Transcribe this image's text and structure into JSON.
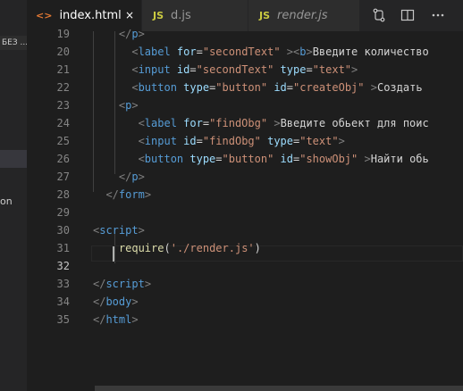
{
  "sidebar": {
    "section_label": "БЕЗ ...",
    "item_label": "on"
  },
  "tabs": [
    {
      "label": "index.html",
      "icon": "<>",
      "active": true,
      "close": "×"
    },
    {
      "label": "d.js",
      "icon": "JS",
      "active": false
    },
    {
      "label": "render.js",
      "icon": "JS",
      "active": false
    }
  ],
  "editor": {
    "current_line": 32,
    "lines": [
      {
        "n": "19",
        "tokens": [
          [
            "t",
            "    </"
          ],
          [
            "tn",
            "p"
          ],
          [
            "t",
            ">"
          ]
        ]
      },
      {
        "n": "20",
        "tokens": [
          [
            "t",
            "      <"
          ],
          [
            "tn",
            "label"
          ],
          [
            "at",
            " for"
          ],
          [
            "tx",
            "="
          ],
          [
            "st",
            "\"secondText\""
          ],
          [
            "tx",
            " "
          ],
          [
            "t",
            "><"
          ],
          [
            "tn",
            "b"
          ],
          [
            "t",
            ">"
          ],
          [
            "tx",
            "Введите количество"
          ]
        ]
      },
      {
        "n": "21",
        "tokens": [
          [
            "t",
            "      <"
          ],
          [
            "tn",
            "input"
          ],
          [
            "at",
            " id"
          ],
          [
            "tx",
            "="
          ],
          [
            "st",
            "\"secondText\""
          ],
          [
            "at",
            " type"
          ],
          [
            "tx",
            "="
          ],
          [
            "st",
            "\"text\""
          ],
          [
            "t",
            ">"
          ]
        ]
      },
      {
        "n": "22",
        "tokens": [
          [
            "t",
            "      <"
          ],
          [
            "tn",
            "button"
          ],
          [
            "at",
            " type"
          ],
          [
            "tx",
            "="
          ],
          [
            "st",
            "\"button\""
          ],
          [
            "at",
            " id"
          ],
          [
            "tx",
            "="
          ],
          [
            "st",
            "\"createObj\""
          ],
          [
            "tx",
            " "
          ],
          [
            "t",
            ">"
          ],
          [
            "tx",
            "Создать"
          ]
        ]
      },
      {
        "n": "23",
        "tokens": [
          [
            "t",
            "    <"
          ],
          [
            "tn",
            "p"
          ],
          [
            "t",
            ">"
          ]
        ]
      },
      {
        "n": "24",
        "tokens": [
          [
            "t",
            "       <"
          ],
          [
            "tn",
            "label"
          ],
          [
            "at",
            " for"
          ],
          [
            "tx",
            "="
          ],
          [
            "st",
            "\"findObg\""
          ],
          [
            "tx",
            " "
          ],
          [
            "t",
            ">"
          ],
          [
            "tx",
            "Введите обьект для поис"
          ]
        ]
      },
      {
        "n": "25",
        "tokens": [
          [
            "t",
            "       <"
          ],
          [
            "tn",
            "input"
          ],
          [
            "at",
            " id"
          ],
          [
            "tx",
            "="
          ],
          [
            "st",
            "\"findObg\""
          ],
          [
            "at",
            " type"
          ],
          [
            "tx",
            "="
          ],
          [
            "st",
            "\"text\""
          ],
          [
            "t",
            ">"
          ]
        ]
      },
      {
        "n": "26",
        "tokens": [
          [
            "t",
            "       <"
          ],
          [
            "tn",
            "button"
          ],
          [
            "at",
            " type"
          ],
          [
            "tx",
            "="
          ],
          [
            "st",
            "\"button\""
          ],
          [
            "at",
            " id"
          ],
          [
            "tx",
            "="
          ],
          [
            "st",
            "\"showObj\""
          ],
          [
            "tx",
            " "
          ],
          [
            "t",
            ">"
          ],
          [
            "tx",
            "Найти обь"
          ]
        ]
      },
      {
        "n": "27",
        "tokens": [
          [
            "t",
            "    </"
          ],
          [
            "tn",
            "p"
          ],
          [
            "t",
            ">"
          ]
        ]
      },
      {
        "n": "28",
        "tokens": [
          [
            "t",
            "  </"
          ],
          [
            "tn",
            "form"
          ],
          [
            "t",
            ">"
          ]
        ]
      },
      {
        "n": "29",
        "tokens": []
      },
      {
        "n": "30",
        "tokens": [
          [
            "t",
            "<"
          ],
          [
            "tn",
            "script"
          ],
          [
            "t",
            ">"
          ]
        ]
      },
      {
        "n": "31",
        "tokens": [
          [
            "tx",
            "    "
          ],
          [
            "fn",
            "require"
          ],
          [
            "tx",
            "("
          ],
          [
            "st",
            "'./render.js'"
          ],
          [
            "tx",
            ")"
          ]
        ]
      },
      {
        "n": "32",
        "tokens": []
      },
      {
        "n": "33",
        "tokens": [
          [
            "t",
            "</"
          ],
          [
            "tn",
            "script"
          ],
          [
            "t",
            ">"
          ]
        ]
      },
      {
        "n": "34",
        "tokens": [
          [
            "t",
            "</"
          ],
          [
            "tn",
            "body"
          ],
          [
            "t",
            ">"
          ]
        ]
      },
      {
        "n": "35",
        "tokens": [
          [
            "t",
            "</"
          ],
          [
            "tn",
            "html"
          ],
          [
            "t",
            ">"
          ]
        ]
      }
    ]
  },
  "colors": {
    "background": "#1e1e1e",
    "tag_punct": "#808080",
    "tag_name": "#569cd6",
    "attribute": "#9cdcfe",
    "string": "#ce9178",
    "function": "#dcdcaa",
    "html_icon": "#e37933",
    "js_icon": "#cbcb41"
  }
}
